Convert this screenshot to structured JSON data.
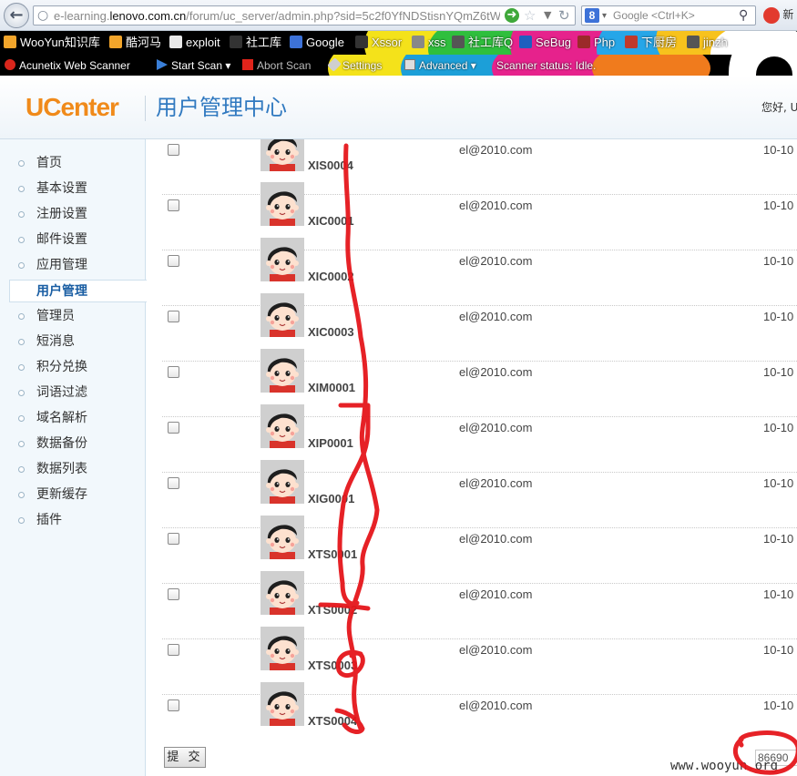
{
  "browser": {
    "url_prefix": "e-learning.",
    "url_host": "lenovo.com.cn",
    "url_path": "/forum/uc_server/admin.php?sid=5c2f0YfNDStisnYQmZ6tW",
    "search_placeholder": "Google <Ctrl+K>",
    "weibo_label": "新"
  },
  "bookmarks": [
    {
      "label": "WooYun知识库",
      "color": "#f2a52b"
    },
    {
      "label": "酷河马",
      "color": "#f2a52b"
    },
    {
      "label": "exploit",
      "color": "#e8e8e8"
    },
    {
      "label": "社工库",
      "color": "#333333"
    },
    {
      "label": "Google",
      "color": "#3d72d8"
    },
    {
      "label": "Xssor",
      "color": "#333333"
    },
    {
      "label": "xss",
      "color": "#888888"
    },
    {
      "label": "社工库Q",
      "color": "#555555"
    },
    {
      "label": "SeBug",
      "color": "#1f5fbf"
    },
    {
      "label": "Php",
      "color": "#9b2a2a"
    },
    {
      "label": "下厨房",
      "color": "#c0392b"
    },
    {
      "label": "jinzh",
      "color": "#555555"
    }
  ],
  "scanner": {
    "name": "Acunetix Web Scanner",
    "start": "Start Scan",
    "abort": "Abort Scan",
    "settings": "Settings",
    "advanced": "Advanced",
    "status": "Scanner status: Idle."
  },
  "header": {
    "logo": "UCenter",
    "title": "用户管理中心",
    "greeting": "您好, U"
  },
  "sidebar": {
    "items": [
      {
        "label": "首页"
      },
      {
        "label": "基本设置"
      },
      {
        "label": "注册设置"
      },
      {
        "label": "邮件设置"
      },
      {
        "label": "应用管理"
      },
      {
        "label": "用户管理",
        "active": true
      },
      {
        "label": "管理员"
      },
      {
        "label": "短消息"
      },
      {
        "label": "积分兑换"
      },
      {
        "label": "词语过滤"
      },
      {
        "label": "域名解析"
      },
      {
        "label": "数据备份"
      },
      {
        "label": "数据列表"
      },
      {
        "label": "更新缓存"
      },
      {
        "label": "插件"
      }
    ]
  },
  "users": [
    {
      "name": "XIS0004",
      "email": "el@2010.com",
      "date": "10-10"
    },
    {
      "name": "XIC0001",
      "email": "el@2010.com",
      "date": "10-10"
    },
    {
      "name": "XIC0002",
      "email": "el@2010.com",
      "date": "10-10"
    },
    {
      "name": "XIC0003",
      "email": "el@2010.com",
      "date": "10-10"
    },
    {
      "name": "XIM0001",
      "email": "el@2010.com",
      "date": "10-10"
    },
    {
      "name": "XIP0001",
      "email": "el@2010.com",
      "date": "10-10"
    },
    {
      "name": "XIG0001",
      "email": "el@2010.com",
      "date": "10-10"
    },
    {
      "name": "XTS0001",
      "email": "el@2010.com",
      "date": "10-10"
    },
    {
      "name": "XTS0002",
      "email": "el@2010.com",
      "date": "10-10"
    },
    {
      "name": "XTS0003",
      "email": "el@2010.com",
      "date": "10-10"
    },
    {
      "name": "XTS0004",
      "email": "el@2010.com",
      "date": "10-10"
    }
  ],
  "footer": {
    "submit": "提 交",
    "total": "86690",
    "watermark": "www.wooyun.org"
  },
  "colors": {
    "accent": "#3079c0",
    "logo": "#f08a1a",
    "annotation": "#e5161b"
  }
}
